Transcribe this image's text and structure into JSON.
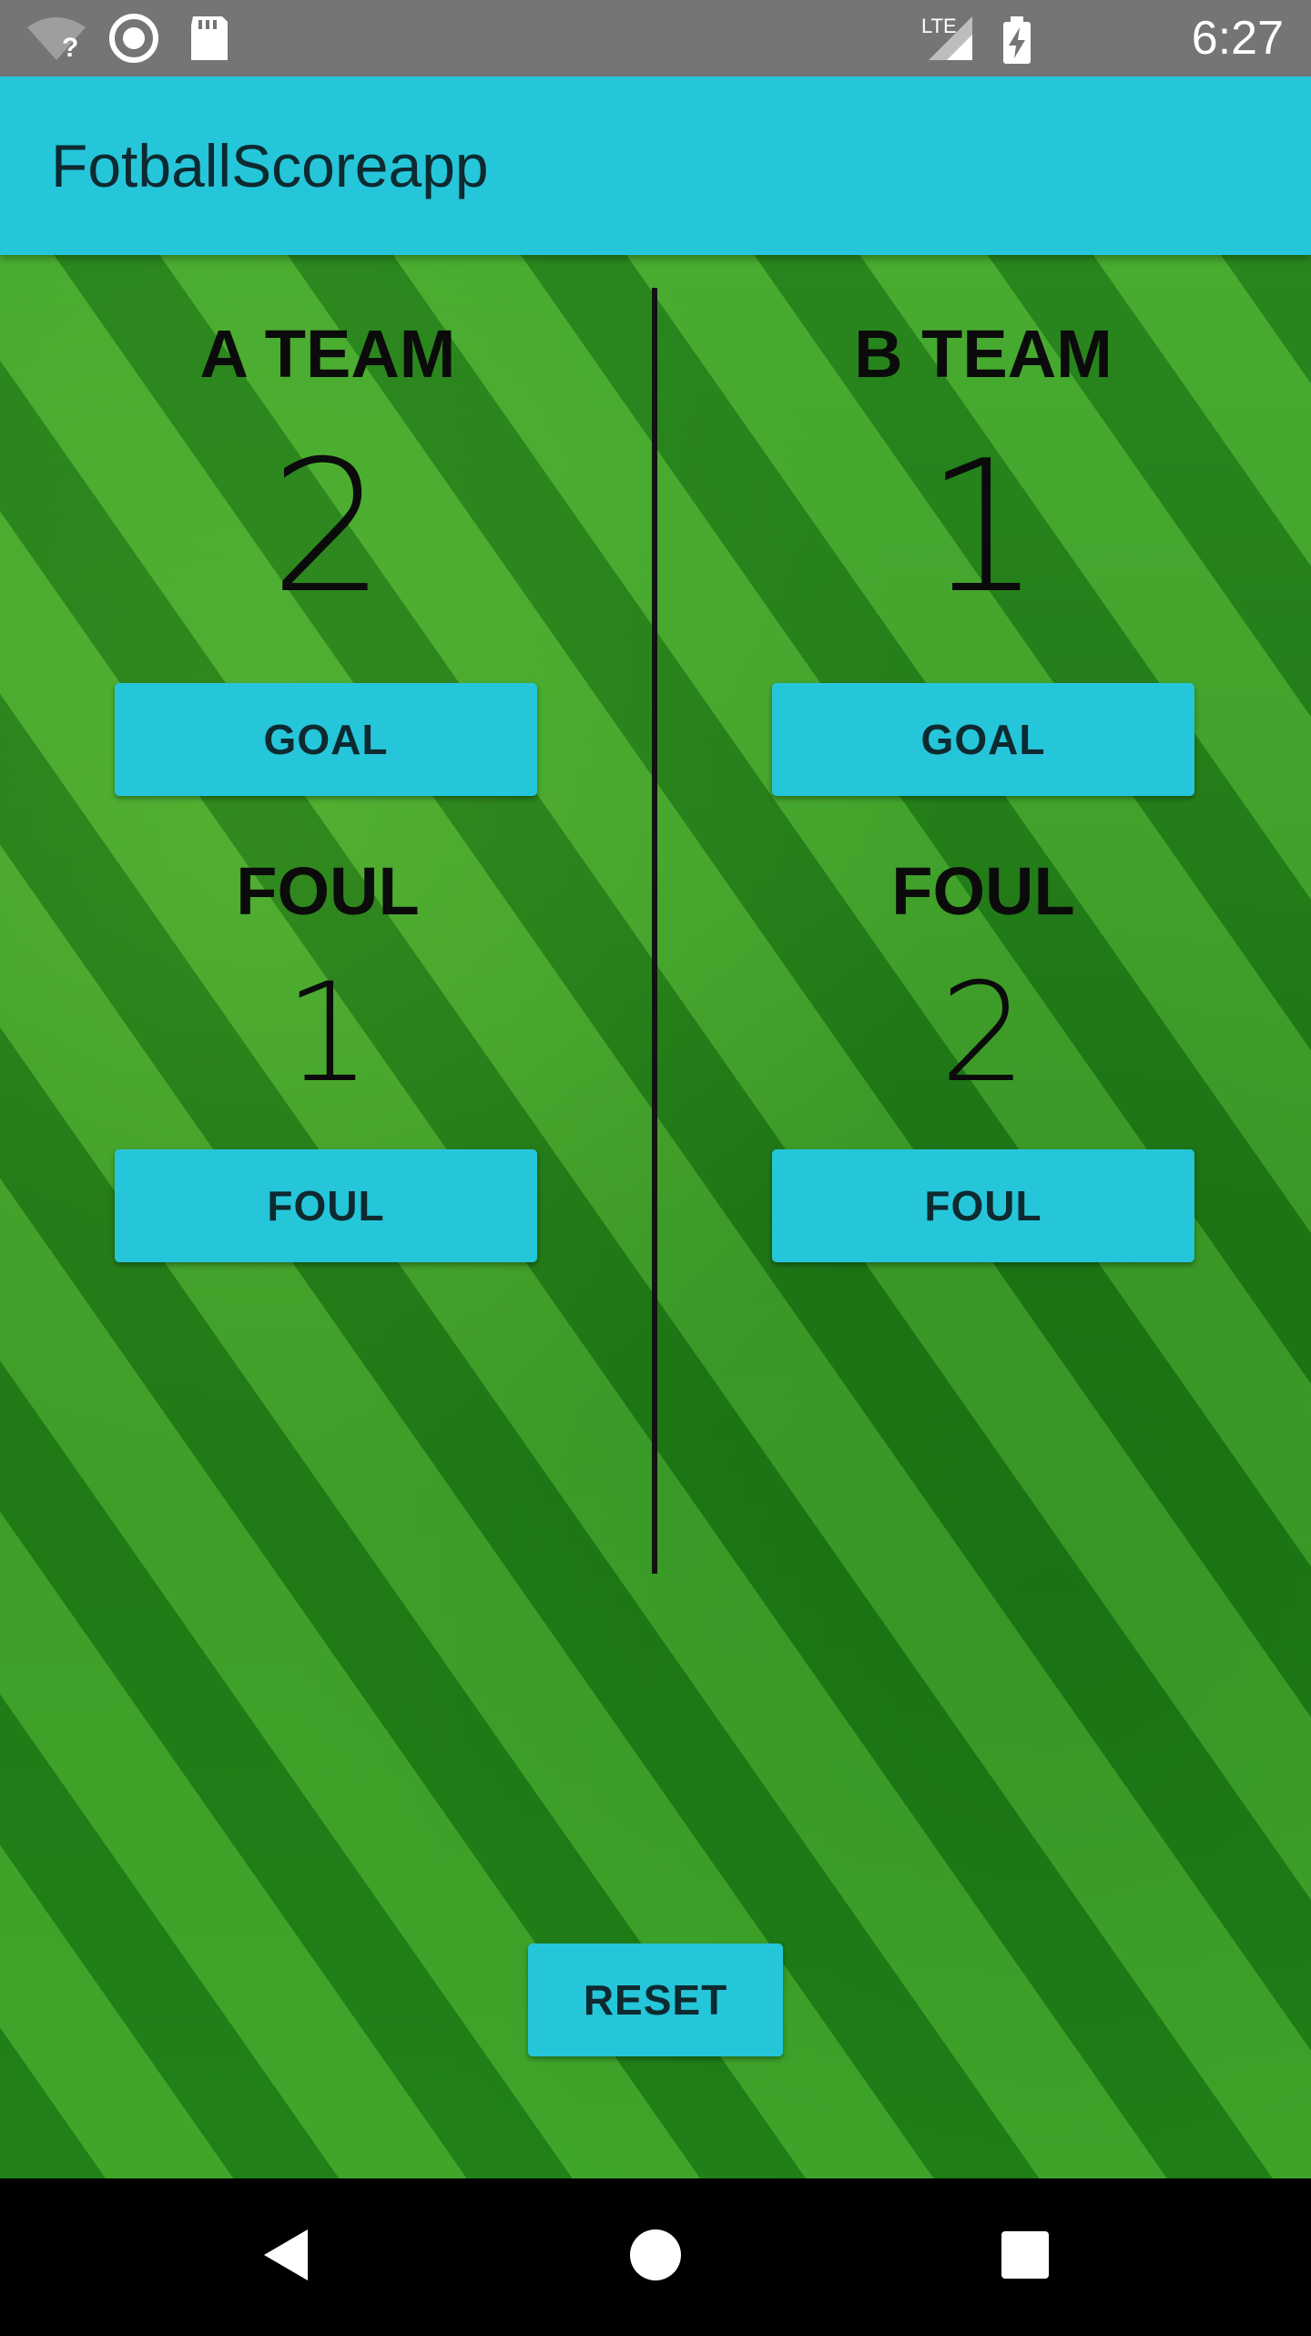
{
  "status_bar": {
    "time": "6:27",
    "icons": [
      "wifi-unknown-icon",
      "sync-circle-icon",
      "sd-card-icon",
      "lte-signal-icon",
      "battery-charging-icon"
    ],
    "network_label": "LTE"
  },
  "app_bar": {
    "title": "FotballScoreapp",
    "color": "#26c6da"
  },
  "team_a": {
    "name": "A TEAM",
    "score": "2",
    "goal_button": "GOAL",
    "foul_label": "FOUL",
    "foul_count": "1",
    "foul_button": "FOUL"
  },
  "team_b": {
    "name": "B TEAM",
    "score": "1",
    "goal_button": "GOAL",
    "foul_label": "FOUL",
    "foul_count": "2",
    "foul_button": "FOUL"
  },
  "reset_button": "RESET",
  "navigation": {
    "icons": [
      "back-icon",
      "home-icon",
      "recents-icon"
    ]
  },
  "colors": {
    "accent": "#26c6da",
    "status_bar": "#757575",
    "field": "#2f8f20"
  }
}
